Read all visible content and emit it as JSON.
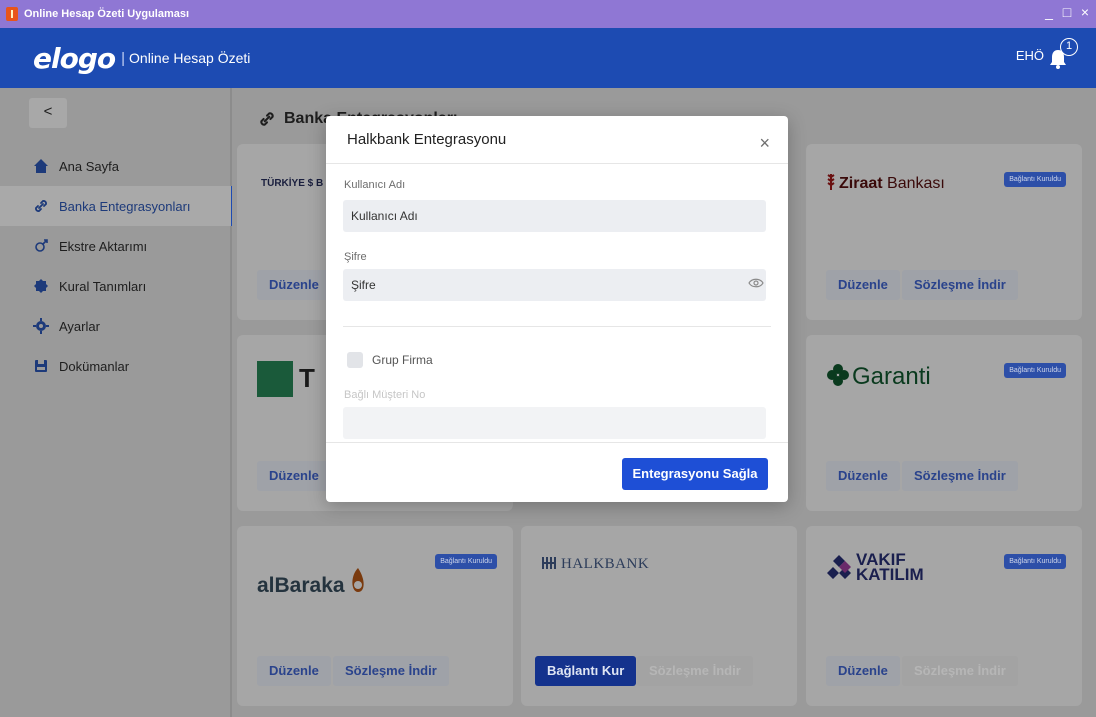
{
  "window": {
    "title": "Online Hesap Özeti Uygulaması",
    "controls": [
      "_",
      "□",
      "×"
    ]
  },
  "header": {
    "logo": "elogo",
    "separator": "|",
    "app_name": "Online Hesap Özeti",
    "user": "EHÖ",
    "notification_count": "1"
  },
  "sidebar": {
    "collapse_label": "<",
    "items": [
      {
        "label": "Ana Sayfa",
        "icon": "home-icon"
      },
      {
        "label": "Banka Entegrasyonları",
        "icon": "link-icon",
        "active": true
      },
      {
        "label": "Ekstre Aktarımı",
        "icon": "transfer-icon"
      },
      {
        "label": "Kural Tanımları",
        "icon": "rules-icon"
      },
      {
        "label": "Ayarlar",
        "icon": "gear-icon"
      },
      {
        "label": "Dokümanlar",
        "icon": "document-icon"
      }
    ]
  },
  "main": {
    "title_visible": "Banka Entegrasyonları",
    "cards": {
      "isbank": {
        "logo": "TÜRKİYE $ B",
        "edit": "Düzenle"
      },
      "ziraat": {
        "logo_bold": "Ziraat",
        "logo_rest": " Bankası",
        "badge": "Bağlantı Kuruldu",
        "edit": "Düzenle",
        "contract": "Sözleşme İndir"
      },
      "teb": {
        "logo": "T",
        "edit": "Düzenle"
      },
      "garanti": {
        "logo": "Garanti",
        "badge": "Bağlantı Kuruldu",
        "edit": "Düzenle",
        "contract": "Sözleşme İndir"
      },
      "albaraka": {
        "logo": "alBaraka",
        "badge": "Bağlantı Kuruldu",
        "edit": "Düzenle",
        "contract": "Sözleşme İndir"
      },
      "halkbank": {
        "logo": "HALKBANK",
        "connect": "Bağlantı Kur",
        "contract": "Sözleşme İndir"
      },
      "vakif": {
        "logo_line1": "VAKIF",
        "logo_line2": "KATILIM",
        "badge": "Bağlantı Kuruldu",
        "edit": "Düzenle",
        "contract": "Sözleşme İndir"
      }
    }
  },
  "modal": {
    "title": "Halkbank Entegrasyonu",
    "close": "×",
    "username_label": "Kullanıcı Adı",
    "username_placeholder": "Kullanıcı Adı",
    "password_label": "Şifre",
    "password_placeholder": "Şifre",
    "group_label": "Grup Firma",
    "customer_no_label": "Bağlı Müşteri No",
    "submit": "Entegrasyonu Sağla"
  }
}
